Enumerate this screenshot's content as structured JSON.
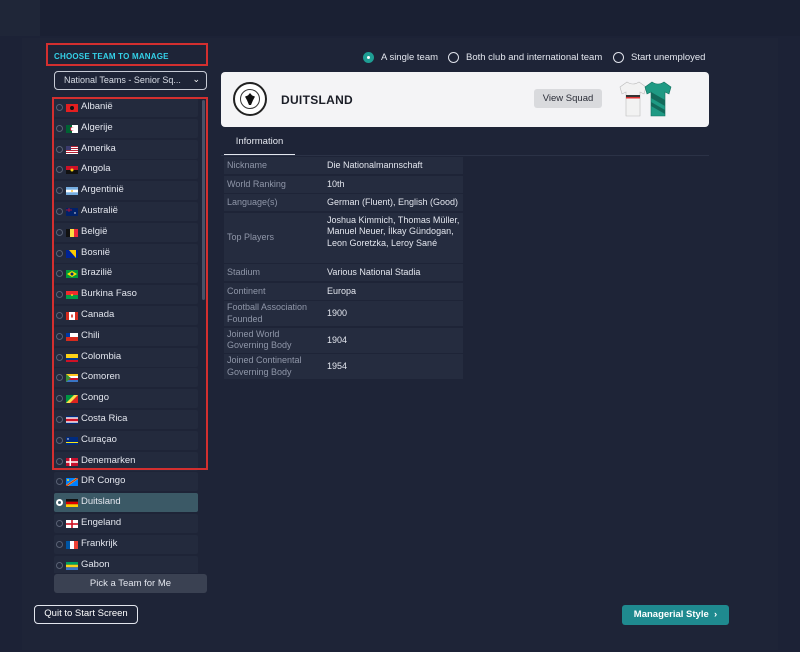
{
  "header": {
    "choose_label": "CHOOSE TEAM TO MANAGE"
  },
  "dropdown": {
    "selected": "National Teams - Senior Sq..."
  },
  "manage_options": [
    {
      "label": "A single team",
      "selected": true
    },
    {
      "label": "Both club and international team",
      "selected": false
    },
    {
      "label": "Start unemployed",
      "selected": false
    }
  ],
  "teams": [
    {
      "name": "Albanië",
      "flag": "albania",
      "selected": false
    },
    {
      "name": "Algerije",
      "flag": "algeria",
      "selected": false
    },
    {
      "name": "Amerika",
      "flag": "usa",
      "selected": false
    },
    {
      "name": "Angola",
      "flag": "angola",
      "selected": false
    },
    {
      "name": "Argentinië",
      "flag": "argentina",
      "selected": false
    },
    {
      "name": "Australië",
      "flag": "australia",
      "selected": false
    },
    {
      "name": "België",
      "flag": "belgium",
      "selected": false
    },
    {
      "name": "Bosnië",
      "flag": "bosnia",
      "selected": false
    },
    {
      "name": "Brazilië",
      "flag": "brazil",
      "selected": false
    },
    {
      "name": "Burkina Faso",
      "flag": "burkina-faso",
      "selected": false
    },
    {
      "name": "Canada",
      "flag": "canada",
      "selected": false
    },
    {
      "name": "Chili",
      "flag": "chile",
      "selected": false
    },
    {
      "name": "Colombia",
      "flag": "colombia",
      "selected": false
    },
    {
      "name": "Comoren",
      "flag": "comoros",
      "selected": false
    },
    {
      "name": "Congo",
      "flag": "congo",
      "selected": false
    },
    {
      "name": "Costa Rica",
      "flag": "costa-rica",
      "selected": false
    },
    {
      "name": "Curaçao",
      "flag": "curacao",
      "selected": false
    },
    {
      "name": "Denemarken",
      "flag": "denmark",
      "selected": false
    },
    {
      "name": "DR Congo",
      "flag": "dr-congo",
      "selected": false
    },
    {
      "name": "Duitsland",
      "flag": "germany",
      "selected": true
    },
    {
      "name": "Engeland",
      "flag": "england",
      "selected": false
    },
    {
      "name": "Frankrijk",
      "flag": "france",
      "selected": false
    },
    {
      "name": "Gabon",
      "flag": "gabon",
      "selected": false
    }
  ],
  "team_card": {
    "name": "DUITSLAND",
    "view_squad_label": "View Squad"
  },
  "tabs": [
    {
      "label": "Information",
      "active": true
    }
  ],
  "info_rows": [
    {
      "label": "Nickname",
      "value": "Die Nationalmannschaft"
    },
    {
      "label": "World Ranking",
      "value": "10th"
    },
    {
      "label": "Language(s)",
      "value": "German (Fluent), English (Good)"
    },
    {
      "label": "Top Players",
      "value": "Joshua Kimmich, Thomas Müller, Manuel Neuer, İlkay Gündogan, Leon Goretzka, Leroy Sané"
    },
    {
      "label": "Stadium",
      "value": "Various National Stadia"
    },
    {
      "label": "Continent",
      "value": "Europa"
    },
    {
      "label": "Football Association Founded",
      "value": "1900"
    },
    {
      "label": "Joined World Governing Body",
      "value": "1904"
    },
    {
      "label": "Joined Continental Governing Body",
      "value": "1954"
    }
  ],
  "buttons": {
    "pick_team": "Pick a Team for Me",
    "quit": "Quit to Start Screen",
    "managerial_style": "Managerial Style"
  },
  "colors": {
    "background": "#1c2236",
    "highlight_red": "#d32f2f",
    "accent_cyan": "#34d1e8",
    "accent_teal": "#1f8a8f",
    "selected_row": "#3b5966"
  }
}
